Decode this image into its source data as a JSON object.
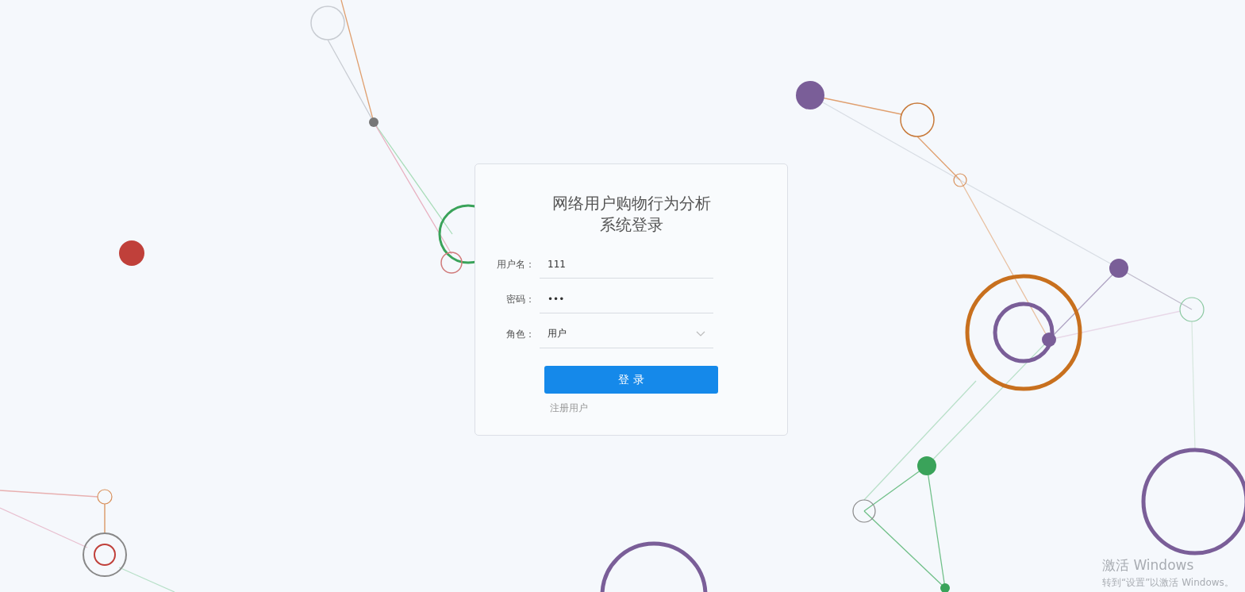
{
  "login": {
    "title_lines": [
      "网络用户购物行为分析",
      "系统登录"
    ],
    "fields": [
      {
        "kind": "text",
        "label": "用户名：",
        "value": "111"
      },
      {
        "kind": "password",
        "label": "密码：",
        "value": "•••"
      },
      {
        "kind": "select",
        "label": "角色：",
        "value": "用户"
      }
    ],
    "submit": "登 录",
    "register_link": "注册用户"
  },
  "os_notice": {
    "title": "激活 Windows",
    "text": "转到“设置”以激活 Windows。"
  }
}
